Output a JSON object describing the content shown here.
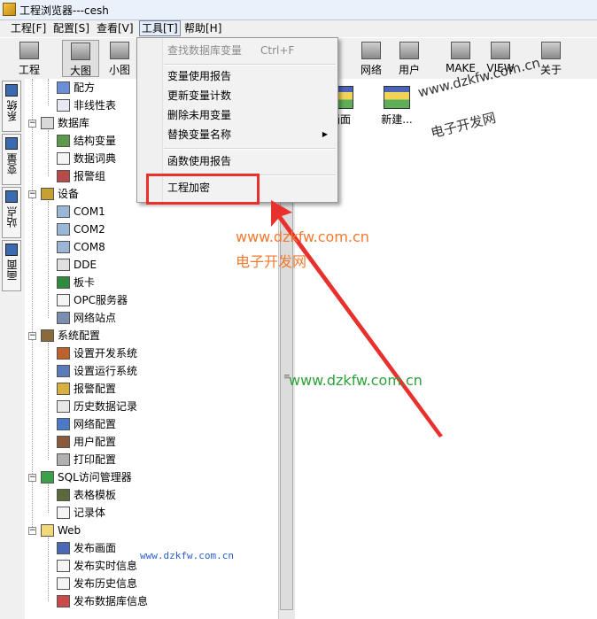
{
  "window": {
    "title": "工程浏览器---cesh"
  },
  "menubar": [
    {
      "label": "工程[F]"
    },
    {
      "label": "配置[S]"
    },
    {
      "label": "查看[V]"
    },
    {
      "label": "工具[T]"
    },
    {
      "label": "帮助[H]"
    }
  ],
  "toolbar": [
    {
      "label": "工程",
      "icon": "project-icon"
    },
    {
      "label": "大图",
      "icon": "large-icon"
    },
    {
      "label": "小图",
      "icon": "small-icon"
    },
    {
      "label": "",
      "icon": ""
    },
    {
      "label": "网络",
      "icon": "network-icon"
    },
    {
      "label": "用户",
      "icon": "user-icon"
    },
    {
      "label": "MAKE",
      "icon": "make-icon"
    },
    {
      "label": "VIEW",
      "icon": "view-icon"
    },
    {
      "label": "关于",
      "icon": "about-icon"
    }
  ],
  "side_tabs": [
    {
      "label": "系统"
    },
    {
      "label": "变量"
    },
    {
      "label": "站点"
    },
    {
      "label": "画面"
    }
  ],
  "tree": {
    "nodes": [
      {
        "label": "配方",
        "icon": "recipe-icon"
      },
      {
        "label": "非线性表",
        "icon": "table-icon"
      },
      {
        "label": "数据库",
        "icon": "database-icon"
      },
      {
        "label": "结构变量",
        "icon": "struct-icon"
      },
      {
        "label": "数据词典",
        "icon": "dictionary-icon"
      },
      {
        "label": "报警组",
        "icon": "alarm-group-icon"
      },
      {
        "label": "设备",
        "icon": "device-icon"
      },
      {
        "label": "COM1",
        "icon": "port-icon"
      },
      {
        "label": "COM2",
        "icon": "port-icon"
      },
      {
        "label": "COM8",
        "icon": "port-icon"
      },
      {
        "label": "DDE",
        "icon": "dde-icon"
      },
      {
        "label": "板卡",
        "icon": "card-icon"
      },
      {
        "label": "OPC服务器",
        "icon": "opc-icon"
      },
      {
        "label": "网络站点",
        "icon": "network-site-icon"
      },
      {
        "label": "系统配置",
        "icon": "config-icon"
      },
      {
        "label": "设置开发系统",
        "icon": "dev-icon"
      },
      {
        "label": "设置运行系统",
        "icon": "run-icon"
      },
      {
        "label": "报警配置",
        "icon": "alarm-icon"
      },
      {
        "label": "历史数据记录",
        "icon": "history-icon"
      },
      {
        "label": "网络配置",
        "icon": "net-config-icon"
      },
      {
        "label": "用户配置",
        "icon": "user-config-icon"
      },
      {
        "label": "打印配置",
        "icon": "print-icon"
      },
      {
        "label": "SQL访问管理器",
        "icon": "sql-icon"
      },
      {
        "label": "表格模板",
        "icon": "template-icon"
      },
      {
        "label": "记录体",
        "icon": "record-icon"
      },
      {
        "label": "Web",
        "icon": "folder-icon"
      },
      {
        "label": "发布画面",
        "icon": "publish-icon"
      },
      {
        "label": "发布实时信息",
        "icon": "doc-icon"
      },
      {
        "label": "发布历史信息",
        "icon": "doc-icon"
      },
      {
        "label": "发布数据库信息",
        "icon": "eraser-icon"
      }
    ]
  },
  "content": {
    "pictures": [
      {
        "label": "画面"
      },
      {
        "label": "新建..."
      }
    ]
  },
  "tools_menu": {
    "items": [
      {
        "label": "查找数据库变量",
        "shortcut": "Ctrl+F"
      },
      {
        "label": "变量使用报告"
      },
      {
        "label": "更新变量计数"
      },
      {
        "label": "删除未用变量"
      },
      {
        "label": "替换变量名称"
      },
      {
        "label": "函数使用报告"
      },
      {
        "label": "工程加密"
      }
    ]
  },
  "watermarks": {
    "a": "www.dzkfw.com.cn",
    "b": "电子开发网",
    "c": "www.dzkfw.com.cn",
    "d": "www.dzkfw.com.cn",
    "e": "www.dzkfw.com.cn",
    "f": "电子开发网"
  },
  "colors": {
    "highlight": "#e8312c",
    "watermark_orange": "#f07a30",
    "watermark_green": "#2ea23a",
    "watermark_blue": "#2a5fd0"
  }
}
